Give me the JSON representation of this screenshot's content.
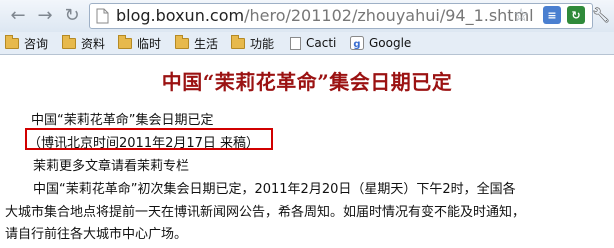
{
  "browser": {
    "url_host": "blog.boxun.com",
    "url_path": "/hero/201102/zhouyahui/94_1.shtml",
    "extensions": [
      {
        "name": "flag-extension-icon",
        "color": "#4a7fd0",
        "label": "≡"
      },
      {
        "name": "refresh-extension-icon",
        "color": "#2f8a3a",
        "label": "↻"
      }
    ]
  },
  "bookmarks": [
    {
      "label": "咨询",
      "icon": "folder-icon"
    },
    {
      "label": "资料",
      "icon": "folder-icon"
    },
    {
      "label": "临时",
      "icon": "folder-icon"
    },
    {
      "label": "生活",
      "icon": "folder-icon"
    },
    {
      "label": "功能",
      "icon": "folder-icon"
    },
    {
      "label": "Cacti",
      "icon": "page-icon"
    },
    {
      "label": "Google",
      "icon": "google-icon"
    }
  ],
  "article": {
    "title": "中国“茉莉花革命”集会日期已定",
    "subtitle": "中国“茉莉花革命”集会日期已定",
    "dateline": "（博讯北京时间2011年2月17日  来稿）",
    "more_link": "茉莉更多文章请看茉莉专栏",
    "body_line1": "中国“茉莉花革命”初次集会日期已定，2011年2月20日（星期天）下午2时，全国各",
    "body_line2": "大城市集合地点将提前一天在博讯新闻网公告，希各周知。如届时情况有变不能及时通知，",
    "body_line3": "请自行前往各大城市中心广场。"
  },
  "colors": {
    "title": "#9b1212",
    "highlight_border": "#d10000"
  }
}
